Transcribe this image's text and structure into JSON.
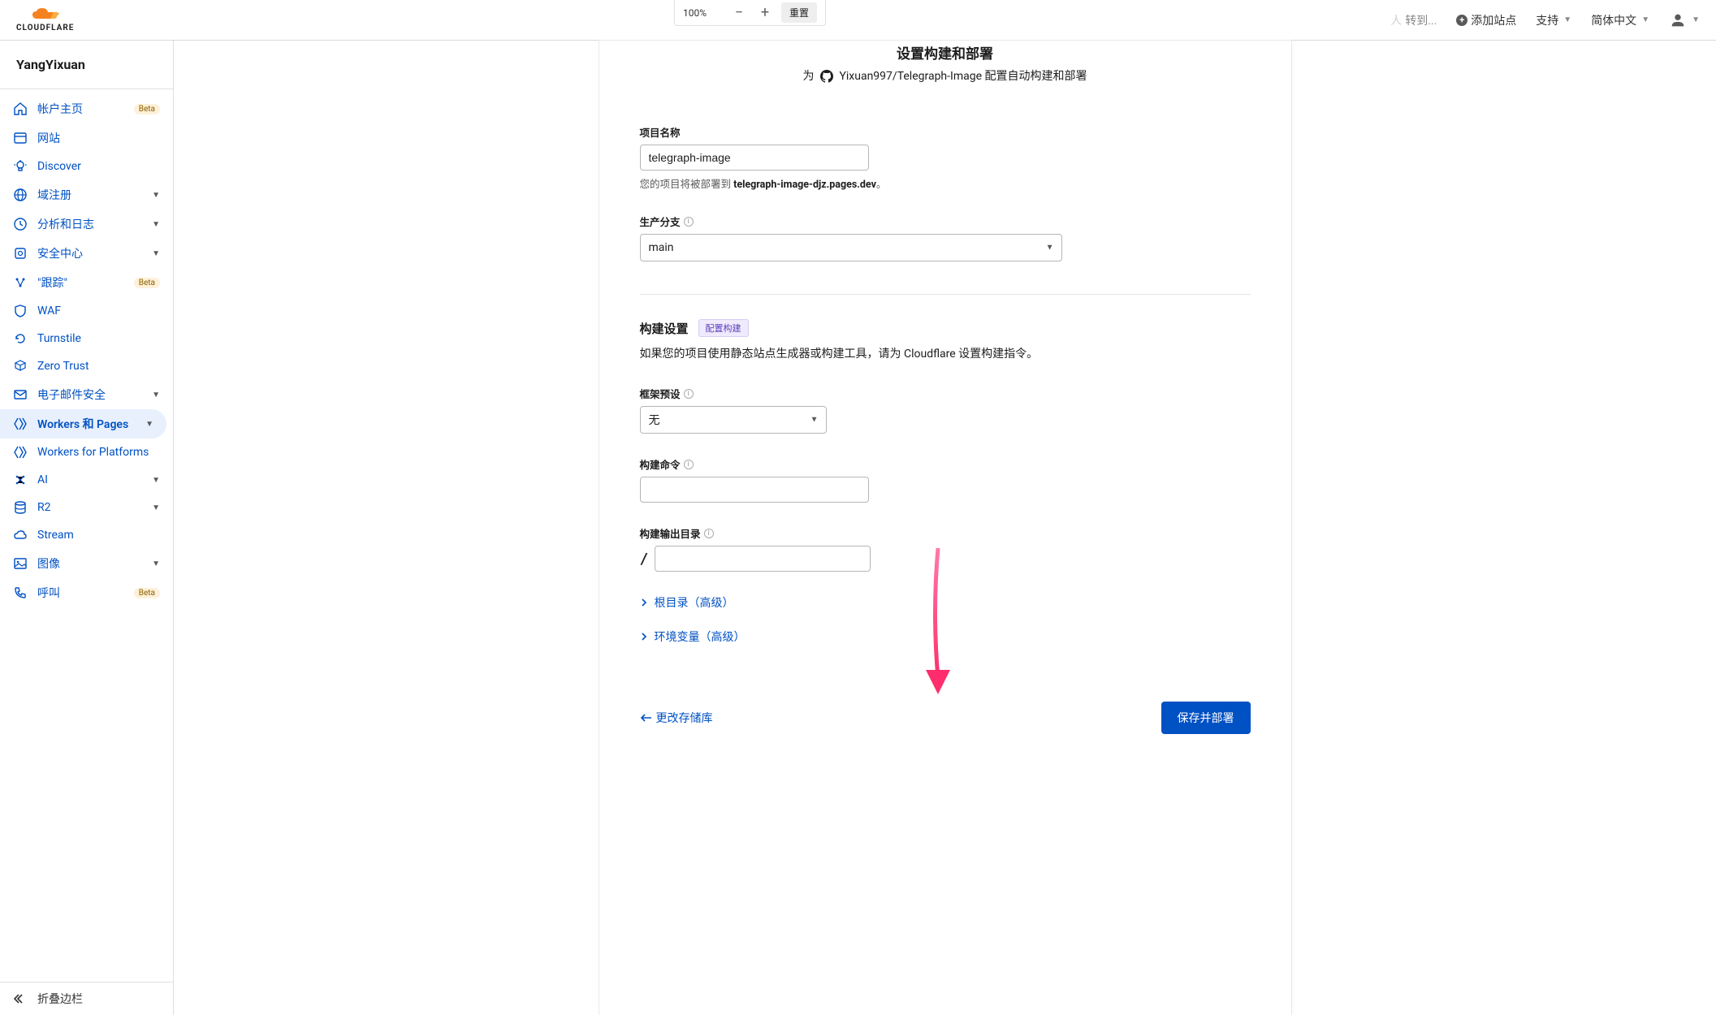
{
  "browser_bar": {
    "zoom": "100%",
    "reset": "重置"
  },
  "header": {
    "search_fragment": "转到...",
    "add_site": "添加站点",
    "support": "支持",
    "language": "简体中文"
  },
  "sidebar": {
    "account": "YangYixuan",
    "items": [
      {
        "label": "帐户主页",
        "badge": "Beta",
        "icon": "home"
      },
      {
        "label": "网站",
        "icon": "browser"
      },
      {
        "label": "Discover",
        "icon": "bulb"
      },
      {
        "label": "域注册",
        "icon": "globe",
        "caret": true
      },
      {
        "label": "分析和日志",
        "icon": "clock",
        "caret": true
      },
      {
        "label": "安全中心",
        "icon": "shield-box",
        "caret": true
      },
      {
        "label": "\"跟踪\"",
        "badge": "Beta",
        "icon": "trace"
      },
      {
        "label": "WAF",
        "icon": "shield"
      },
      {
        "label": "Turnstile",
        "icon": "refresh"
      },
      {
        "label": "Zero Trust",
        "icon": "zt"
      },
      {
        "label": "电子邮件安全",
        "icon": "mail",
        "caret": true
      },
      {
        "label": "Workers 和 Pages",
        "icon": "workers",
        "caret": true,
        "active": true
      },
      {
        "label": "Workers for Platforms",
        "icon": "workers"
      },
      {
        "label": "AI",
        "icon": "ai",
        "caret": true
      },
      {
        "label": "R2",
        "icon": "db",
        "caret": true
      },
      {
        "label": "Stream",
        "icon": "cloud"
      },
      {
        "label": "图像",
        "icon": "image",
        "caret": true
      },
      {
        "label": "呼叫",
        "badge": "Beta",
        "icon": "phone"
      }
    ],
    "collapse": "折叠边栏"
  },
  "page": {
    "heading": "设置构建和部署",
    "subhead_prefix": "为",
    "repo": "Yixuan997/Telegraph-Image",
    "subhead_suffix": "配置自动构建和部署",
    "project_name_label": "项目名称",
    "project_name_value": "telegraph-image",
    "deploy_help_prefix": "您的项目将被部署到 ",
    "deploy_domain": "telegraph-image-djz.pages.dev",
    "deploy_help_suffix": "。",
    "branch_label": "生产分支",
    "branch_value": "main",
    "build_section": "构建设置",
    "build_badge": "配置构建",
    "build_desc": "如果您的项目使用静态站点生成器或构建工具，请为 Cloudflare 设置构建指令。",
    "framework_label": "框架预设",
    "framework_value": "无",
    "build_cmd_label": "构建命令",
    "build_cmd_value": "",
    "output_label": "构建输出目录",
    "output_prefix": "/",
    "output_value": "",
    "root_dir": "根目录（高级）",
    "env_var": "环境变量（高级）",
    "back": "更改存储库",
    "submit": "保存并部署"
  }
}
